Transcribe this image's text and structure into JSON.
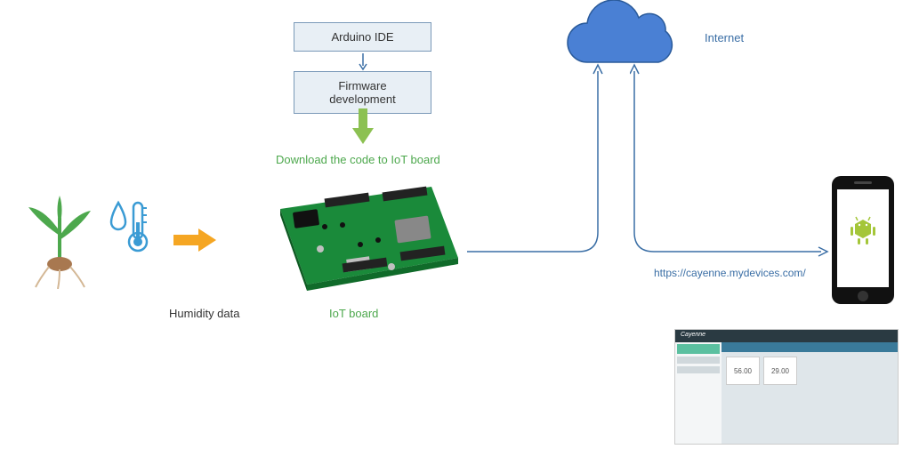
{
  "boxes": {
    "arduino_ide": "Arduino IDE",
    "firmware_dev": "Firmware development"
  },
  "labels": {
    "download_code": "Download the code to IoT board",
    "humidity_data": "Humidity data",
    "iot_board": "IoT board",
    "internet": "Internet",
    "cayenne_url": "https://cayenne.mydevices.com/"
  },
  "colors": {
    "blue": "#3a6ea5",
    "green_text": "#4da84d",
    "cloud_blue": "#4a80d4",
    "orange": "#f5a623",
    "green_arrow": "#8cc152",
    "pcb_green": "#1a8a3a"
  },
  "dashboard": {
    "brand": "Cayenne",
    "val1": "56.00",
    "val2": "29.00"
  }
}
